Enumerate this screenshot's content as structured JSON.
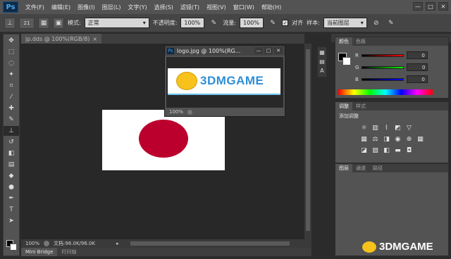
{
  "app": {
    "logo": "Ps"
  },
  "menu": [
    "文件(F)",
    "编辑(E)",
    "图像(I)",
    "图层(L)",
    "文字(Y)",
    "选择(S)",
    "滤镜(T)",
    "视图(V)",
    "窗口(W)",
    "帮助(H)"
  ],
  "window_controls": [
    "—",
    "□",
    "✕"
  ],
  "options": {
    "brush_size": "21",
    "mode_label": "模式:",
    "mode_value": "正常",
    "opacity_label": "不透明度:",
    "opacity_value": "100%",
    "flow_label": "流量:",
    "flow_value": "100%",
    "align_label": "对齐",
    "align_checked": true,
    "sample_label": "样本:",
    "sample_value": "当前图层"
  },
  "document": {
    "tab_label": "jp.dds @ 100%(RGB/8)",
    "tab_close": "×",
    "zoom": "100%",
    "doc_info": "文档:96.0K/96.0K",
    "image_colors": {
      "background": "#ffffff",
      "disc": "#bc002d"
    }
  },
  "floating_window": {
    "title": "logo.jpg @ 100%(RG...",
    "ps_mini": "Ps",
    "controls": [
      "—",
      "□",
      "✕"
    ],
    "zoom": "100%",
    "logo_text": "3DMGAME"
  },
  "bottom_tabs": [
    "Mini Bridge",
    "时间轴"
  ],
  "panels": {
    "color": {
      "tabs": [
        "颜色",
        "色板"
      ],
      "rows": [
        {
          "label": "R",
          "value": "0",
          "color": "#d02020"
        },
        {
          "label": "G",
          "value": "0",
          "color": "#20b020"
        },
        {
          "label": "B",
          "value": "0",
          "color": "#2040d0"
        }
      ]
    },
    "adjustments": {
      "tabs": [
        "调整",
        "样式"
      ],
      "title": "添加调整",
      "icons": [
        "brightness-icon",
        "levels-icon",
        "curves-icon",
        "exposure-icon",
        "vibrance-icon",
        "hsl-icon",
        "color-balance-icon",
        "black-white-icon",
        "photo-filter-icon",
        "channel-mixer-icon",
        "color-lookup-icon",
        "invert-icon",
        "posterize-icon",
        "threshold-icon",
        "gradient-map-icon",
        "selective-color-icon"
      ]
    },
    "layers": {
      "tabs": [
        "图层",
        "通道",
        "路径"
      ]
    }
  },
  "watermark": "3DMGAME"
}
